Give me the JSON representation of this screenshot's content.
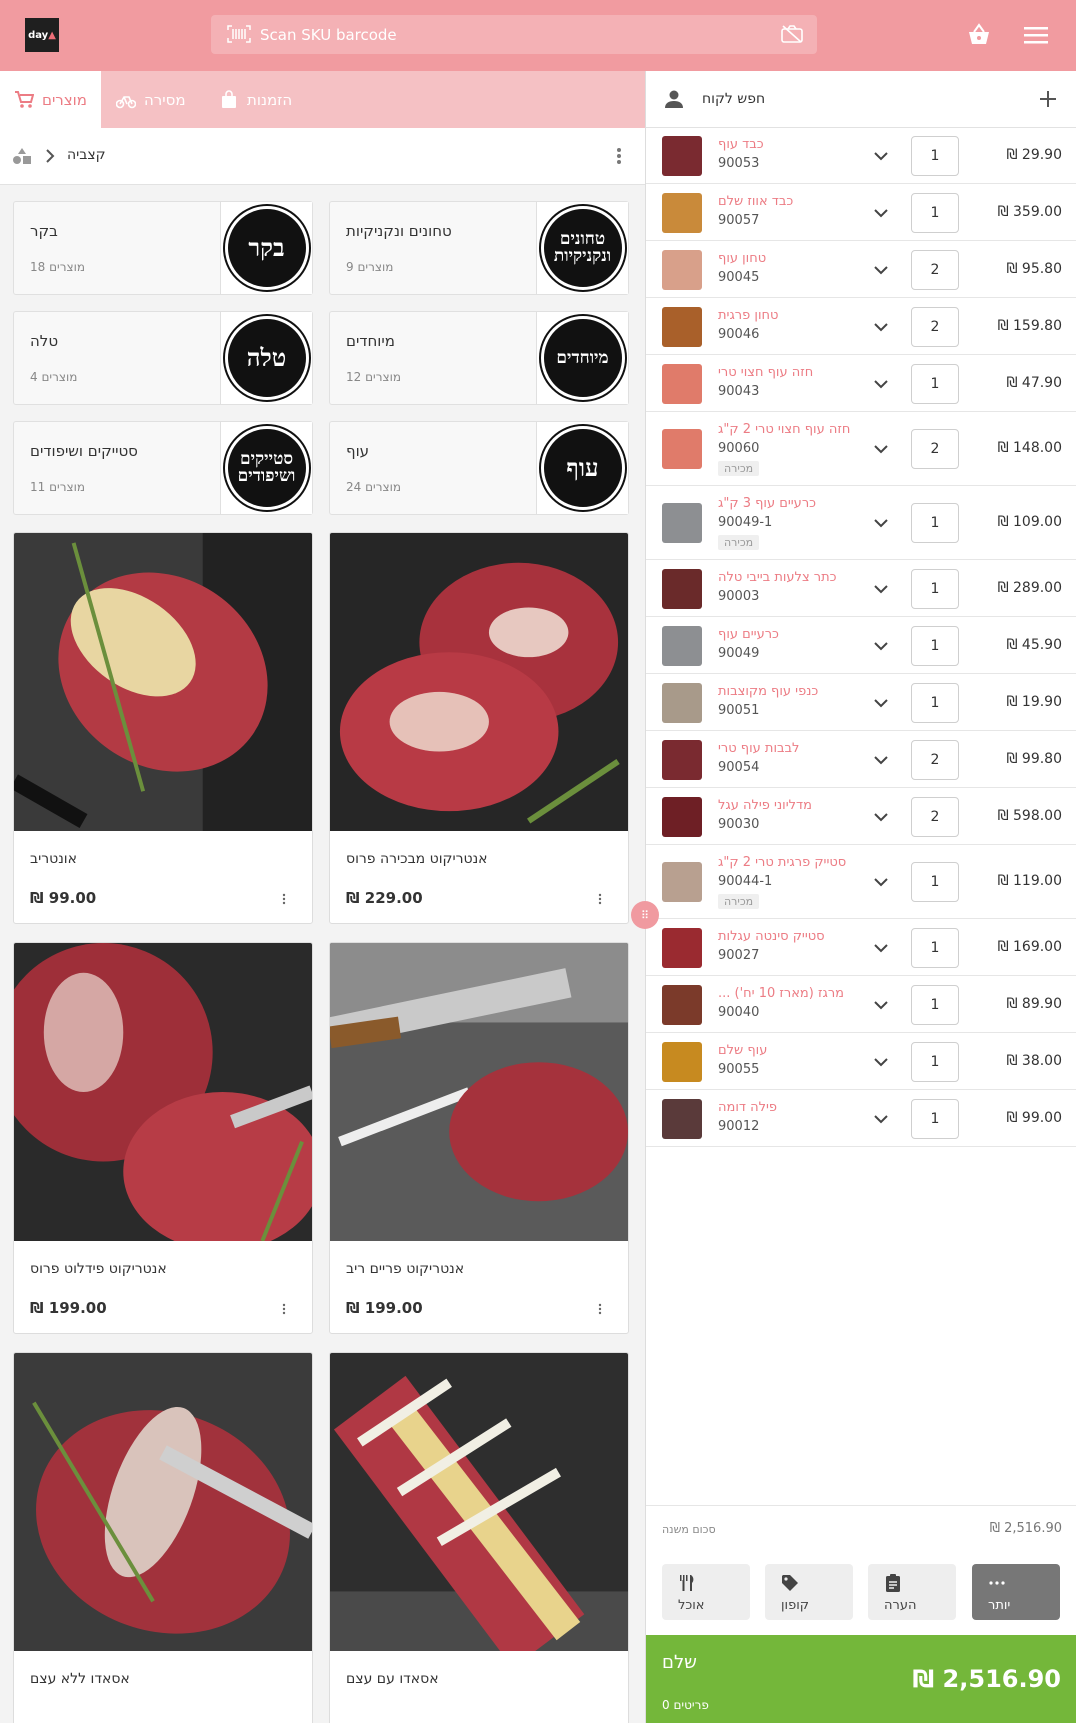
{
  "header": {
    "logo_text": "day",
    "scan_placeholder": "Scan SKU barcode"
  },
  "tabs": [
    {
      "label": "מוצרים",
      "icon": "cart-icon"
    },
    {
      "label": "מסירה",
      "icon": "bike-icon"
    },
    {
      "label": "הזמנות",
      "icon": "bag-icon"
    }
  ],
  "breadcrumb": {
    "label": "קצביה"
  },
  "categories": [
    {
      "name": "טחונים ונקניקיות",
      "count": "9 מוצרים",
      "badge": "טחונים ונקניקיות"
    },
    {
      "name": "בקר",
      "count": "18 מוצרים",
      "badge": "בקר"
    },
    {
      "name": "מיוחדים",
      "count": "12 מוצרים",
      "badge": "מיוחדים"
    },
    {
      "name": "טלה",
      "count": "4 מוצרים",
      "badge": "טלה"
    },
    {
      "name": "עוף",
      "count": "24 מוצרים",
      "badge": "עוף"
    },
    {
      "name": "סטייקים ושיפודים",
      "count": "11 מוצרים",
      "badge": "סטייקים ושיפודים"
    }
  ],
  "products": [
    {
      "name": "אנטריקוט מבכירה פרוס",
      "price": "₪ 229.00"
    },
    {
      "name": "אונטריב",
      "price": "₪ 99.00"
    },
    {
      "name": "אנטריקוט פריים ריב",
      "price": "₪ 199.00"
    },
    {
      "name": "אנטריקוט פידלוט פרוס",
      "price": "₪ 199.00"
    },
    {
      "name": "אסאדו עם עצם",
      "price": ""
    },
    {
      "name": "אסאדו ללא עצם",
      "price": ""
    }
  ],
  "cart": {
    "customer_placeholder": "חפש לקוח",
    "items": [
      {
        "name": "כבד עוף",
        "sku": "90053",
        "qty": "1",
        "price": "₪ 29.90",
        "sale": ""
      },
      {
        "name": "כבד אווז שלם",
        "sku": "90057",
        "qty": "1",
        "price": "₪ 359.00",
        "sale": ""
      },
      {
        "name": "טחון עוף",
        "sku": "90045",
        "qty": "2",
        "price": "₪ 95.80",
        "sale": ""
      },
      {
        "name": "טחון פרגית",
        "sku": "90046",
        "qty": "2",
        "price": "₪ 159.80",
        "sale": ""
      },
      {
        "name": "חזה עוף חצוי טרי",
        "sku": "90043",
        "qty": "1",
        "price": "₪ 47.90",
        "sale": ""
      },
      {
        "name": "חזה עוף חצוי טרי 2 ק\"ג",
        "sku": "90060",
        "qty": "2",
        "price": "₪ 148.00",
        "sale": "מכירה"
      },
      {
        "name": "כרעיים עוף 3 ק\"ג",
        "sku": "90049-1",
        "qty": "1",
        "price": "₪ 109.00",
        "sale": "מכירה"
      },
      {
        "name": "כתר צלעות בייבי טלה",
        "sku": "90003",
        "qty": "1",
        "price": "₪ 289.00",
        "sale": ""
      },
      {
        "name": "כרעיים עוף",
        "sku": "90049",
        "qty": "1",
        "price": "₪ 45.90",
        "sale": ""
      },
      {
        "name": "כנפי עוף מקוצבות",
        "sku": "90051",
        "qty": "1",
        "price": "₪ 19.90",
        "sale": ""
      },
      {
        "name": "לבבות עוף טרי",
        "sku": "90054",
        "qty": "2",
        "price": "₪ 99.80",
        "sale": ""
      },
      {
        "name": "מדליוני פילה עגל",
        "sku": "90030",
        "qty": "2",
        "price": "₪ 598.00",
        "sale": ""
      },
      {
        "name": "סטייק פרגית טרי 2 ק\"ג",
        "sku": "90044-1",
        "qty": "1",
        "price": "₪ 119.00",
        "sale": "מכירה"
      },
      {
        "name": "סטייק סינטה עגלות",
        "sku": "90027",
        "qty": "1",
        "price": "₪ 169.00",
        "sale": ""
      },
      {
        "name": "... מרגז (מארז 10 יח')",
        "sku": "90040",
        "qty": "1",
        "price": "₪ 89.90",
        "sale": ""
      },
      {
        "name": "עוף שלם",
        "sku": "90055",
        "qty": "1",
        "price": "₪ 38.00",
        "sale": ""
      },
      {
        "name": "פילה דומה",
        "sku": "90012",
        "qty": "1",
        "price": "₪ 99.00",
        "sale": ""
      }
    ],
    "subtotal_label": "סכום משנה",
    "subtotal_value": "₪ 2,516.90",
    "actions": [
      {
        "label": "אוכל",
        "icon": "cutlery-icon"
      },
      {
        "label": "קופון",
        "icon": "tag-icon"
      },
      {
        "label": "הערה",
        "icon": "clipboard-icon"
      },
      {
        "label": "יותר",
        "icon": "more-icon"
      }
    ],
    "pay_label": "שלם",
    "pay_total": "₪ 2,516.90",
    "items_count": "0 פריטים"
  },
  "colors": {
    "brand": "#f19ba0",
    "accent": "#ec7c84",
    "pay": "#74b73a"
  }
}
